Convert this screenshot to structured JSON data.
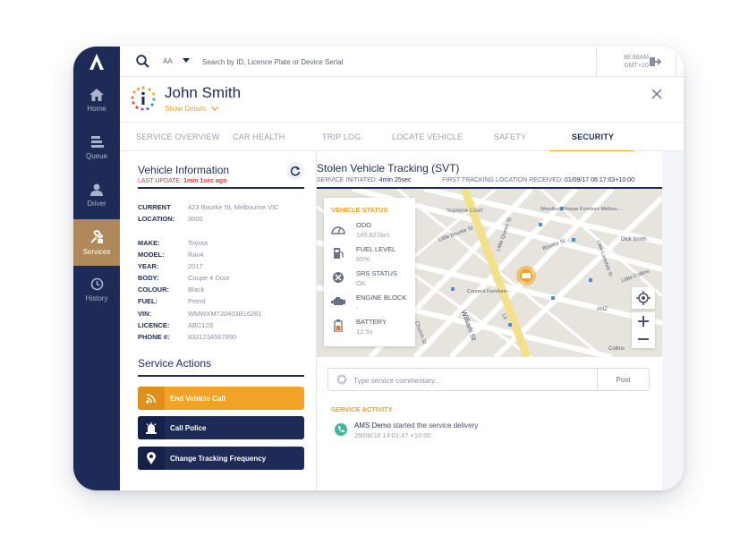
{
  "colors": {
    "navy": "#1e2b57",
    "accent": "#f2a226",
    "active_nav": "#b0895a",
    "alert_red": "#d93b3b",
    "activity_green": "#3cb8a0"
  },
  "sidebar": {
    "logo_icon": "app-logo-icon",
    "items": [
      {
        "label": "Home",
        "icon": "home-icon",
        "active": false
      },
      {
        "label": "Queue",
        "icon": "queue-icon",
        "active": false
      },
      {
        "label": "Driver",
        "icon": "person-icon",
        "active": false
      },
      {
        "label": "Services",
        "icon": "wrench-tools-icon",
        "active": true
      },
      {
        "label": "History",
        "icon": "history-icon",
        "active": false
      }
    ]
  },
  "topbar": {
    "scope": "AA",
    "search_placeholder": "Search by ID, Licence Plate or Device Serial",
    "clock_time": "88:88AM",
    "clock_zone": "GMT+10"
  },
  "profile": {
    "name": "John Smith",
    "show_details": "Show Details"
  },
  "tabs": [
    {
      "label": "SERVICE OVERVIEW",
      "active": false
    },
    {
      "label": "CAR HEALTH",
      "active": false
    },
    {
      "label": "TRIP LOG",
      "active": false
    },
    {
      "label": "LOCATE VEHICLE",
      "active": false
    },
    {
      "label": "SAFETY",
      "active": false
    },
    {
      "label": "SECURITY",
      "active": true
    }
  ],
  "vehicle_info": {
    "title": "Vehicle Information",
    "last_update_label": "LAST UPDATE:",
    "last_update_value": "1min 1sec ago",
    "location_rows": [
      {
        "label": "CURRENT",
        "value": "423 Bourke St, Melbourne VIC"
      },
      {
        "label": "LOCATION:",
        "value": "3000"
      }
    ],
    "rows": [
      {
        "label": "MAKE:",
        "value": "Toyota"
      },
      {
        "label": "MODEL:",
        "value": "Rav4"
      },
      {
        "label": "YEAR:",
        "value": "2017"
      },
      {
        "label": "BODY:",
        "value": "Coupe 4 Door"
      },
      {
        "label": "COLOUR:",
        "value": "Black"
      },
      {
        "label": "FUEL:",
        "value": "Petrol"
      },
      {
        "label": "VIN:",
        "value": "WMWXM720403B16261"
      },
      {
        "label": "LICENCE:",
        "value": "ABC123"
      },
      {
        "label": "PHONE #:",
        "value": "8321234567890"
      }
    ]
  },
  "service_actions": {
    "title": "Service Actions",
    "buttons": [
      {
        "label": "End Vehicle Call",
        "icon": "phone-signal-icon"
      },
      {
        "label": "Call Police",
        "icon": "police-siren-icon"
      },
      {
        "label": "Change Tracking Frequency",
        "icon": "location-pin-icon"
      }
    ]
  },
  "svt": {
    "title": "Stolen Vehicle Tracking (SVT)",
    "initiated_label": "SERVICE INITIATED:",
    "initiated_value": "4min 25sec",
    "first_location_label": "FIRST TRACKING LOCATION RECEIVED:",
    "first_location_value": "01/09/17 06:17:03+10:00"
  },
  "map": {
    "street_labels": [
      "Supreme Court",
      "Little Bourke St",
      "Little Queen St",
      "Bourke St",
      "Woodbury House Furniture Melbou...",
      "Dick Smith",
      "Little Collins",
      "William St",
      "Church St",
      "Connect Furniture",
      "ANZ",
      "Collins",
      "Lit",
      "Little Lonsdale St"
    ]
  },
  "vehicle_status": {
    "title": "VEHICLE STATUS",
    "items": [
      {
        "label": "ODO",
        "value": "145,621km",
        "icon": "odometer-icon"
      },
      {
        "label": "FUEL LEVEL",
        "value": "65%",
        "icon": "fuel-pump-icon"
      },
      {
        "label": "SRS STATUS",
        "value": "OK",
        "icon": "airbag-icon"
      },
      {
        "label": "ENGINE BLOCK",
        "value": "-",
        "icon": "engine-icon"
      },
      {
        "label": "BATTERY",
        "value": "12.5v",
        "icon": "battery-icon"
      }
    ]
  },
  "comment": {
    "placeholder": "Type service commentary...",
    "post_label": "Post"
  },
  "activity": {
    "title": "SERVICE ACTIVITY",
    "items": [
      {
        "actor": "AMS Demo",
        "text": "started the service delivery",
        "time": "29/06/18 14:01:47 +10:00"
      }
    ]
  }
}
